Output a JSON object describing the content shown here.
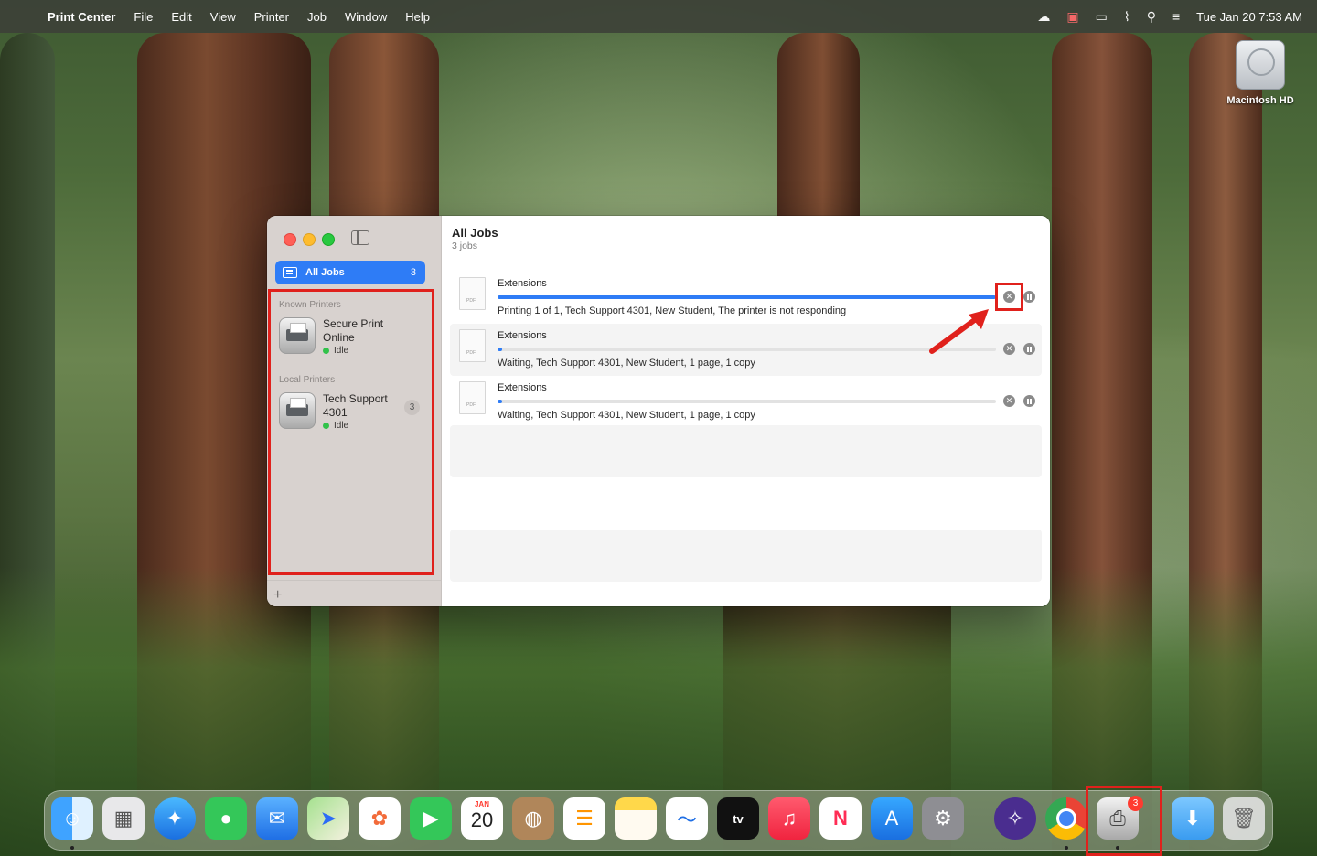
{
  "menubar": {
    "app_name": "Print Center",
    "menus": [
      "File",
      "Edit",
      "View",
      "Printer",
      "Job",
      "Window",
      "Help"
    ],
    "clock": "Tue Jan 20  7:53 AM"
  },
  "desktop": {
    "drive_label": "Macintosh HD"
  },
  "window": {
    "sidebar": {
      "all_jobs_label": "All Jobs",
      "all_jobs_count": "3",
      "known_section": "Known Printers",
      "local_section": "Local Printers",
      "printers": [
        {
          "name": "Secure Print Online",
          "status": "Idle",
          "badge": ""
        },
        {
          "name": "Tech Support 4301",
          "status": "Idle",
          "badge": "3"
        }
      ],
      "add_label": "+"
    },
    "main": {
      "title": "All Jobs",
      "subtitle": "3 jobs",
      "jobs": [
        {
          "name": "Extensions",
          "progress": 1.0,
          "status": "Printing 1 of 1, Tech Support 4301, New Student, The printer is not responding",
          "highlighted_cancel": true
        },
        {
          "name": "Extensions",
          "progress": 0.01,
          "status": "Waiting, Tech Support 4301, New Student, 1 page, 1 copy",
          "highlighted_cancel": false
        },
        {
          "name": "Extensions",
          "progress": 0.01,
          "status": "Waiting, Tech Support 4301, New Student, 1 page, 1 copy",
          "highlighted_cancel": false
        }
      ]
    }
  },
  "dock": {
    "calendar_month": "JAN",
    "calendar_day": "20",
    "print_center_badge": "3",
    "apps": [
      "finder-icon",
      "launchpad-icon",
      "safari-icon",
      "messages-icon",
      "mail-icon",
      "maps-icon",
      "photos-icon",
      "facetime-icon",
      "calendar-icon",
      "contacts-icon",
      "reminders-icon",
      "notes-icon",
      "freeform-icon",
      "apple-tv-icon",
      "music-icon",
      "news-icon",
      "app-store-icon",
      "system-settings-icon",
      "university-icon",
      "chrome-icon",
      "print-center-icon",
      "downloads-folder-icon",
      "trash-icon"
    ]
  },
  "colors": {
    "accent": "#2e7cf6",
    "annotation": "#e0211c"
  }
}
